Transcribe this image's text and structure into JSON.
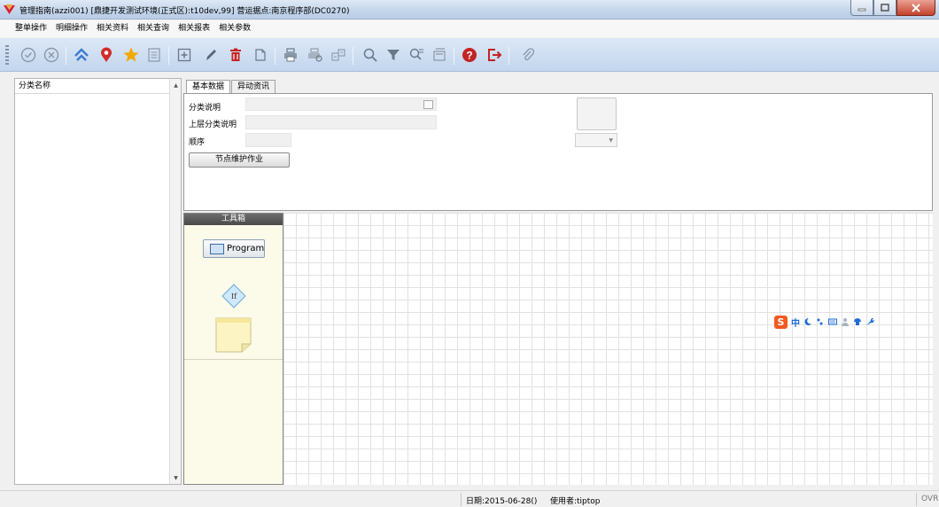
{
  "window": {
    "title": "管理指南(azzi001)    [鼎捷开发测试环境(正式区):t10dev,99]    营运据点:南京程序部(DC0270)"
  },
  "menu": {
    "items": [
      "整单操作",
      "明细操作",
      "相关资料",
      "相关查询",
      "相关报表",
      "相关参数"
    ]
  },
  "toolbar": {
    "icons": [
      "confirm-icon",
      "cancel-icon",
      "home-icon",
      "location-icon",
      "favorite-icon",
      "list-icon",
      "add-icon",
      "edit-icon",
      "delete-icon",
      "copy-icon",
      "print-icon",
      "print-preview-icon",
      "export-icon",
      "search-icon",
      "filter-icon",
      "clear-filter-icon",
      "batch-icon",
      "help-icon",
      "exit-icon",
      "attachment-icon"
    ]
  },
  "tree": {
    "header": "分类名称"
  },
  "tabs": {
    "basic": "基本数据",
    "changes": "异动资讯"
  },
  "form": {
    "category_desc_label": "分类说明",
    "category_desc_value": "",
    "parent_desc_label": "上层分类说明",
    "parent_desc_value": "",
    "order_label": "顺序",
    "order_value": "",
    "node_button": "节点维护作业"
  },
  "toolbox": {
    "title": "工具箱",
    "program": "Program",
    "if": "If"
  },
  "ime": {
    "logo": "S",
    "mode": "中"
  },
  "status": {
    "date": "日期:2015-06-28()",
    "user": "使用者:tiptop",
    "mode": "OVR"
  },
  "colors": {
    "titlebar": "#c6d7ec",
    "toolbar": "#c3d6ee",
    "toolbox_bg": "#fcfae8",
    "accent_blue": "#3b7bd2",
    "star": "#f2a900",
    "pin": "#d12b2b",
    "ime_orange": "#f25a20"
  }
}
